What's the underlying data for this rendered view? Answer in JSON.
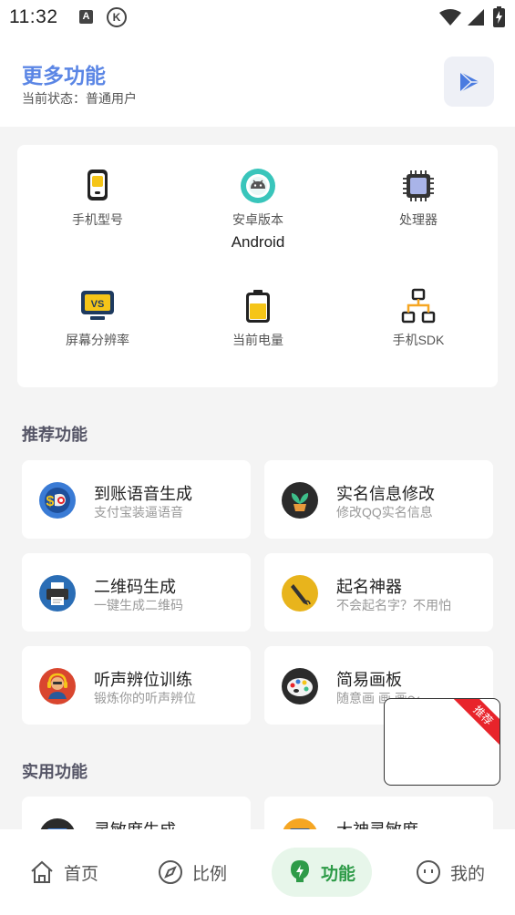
{
  "status_bar": {
    "time": "11:32",
    "a_badge": "A",
    "k_badge": "K"
  },
  "header": {
    "title": "更多功能",
    "status": "当前状态：普通用户",
    "action_icon": "play-icon",
    "accent": "#5b86e5"
  },
  "device_info": [
    {
      "label": "手机型号",
      "value": "",
      "icon": "phone-icon"
    },
    {
      "label": "安卓版本",
      "value": "Android",
      "icon": "android-icon"
    },
    {
      "label": "处理器",
      "value": "",
      "icon": "cpu-icon"
    },
    {
      "label": "屏幕分辨率",
      "value": "",
      "icon": "monitor-icon"
    },
    {
      "label": "当前电量",
      "value": "",
      "icon": "battery-icon"
    },
    {
      "label": "手机SDK",
      "value": "",
      "icon": "sdk-icon"
    }
  ],
  "recommended": {
    "title": "推荐功能",
    "items": [
      {
        "title": "到账语音生成",
        "subtitle": "支付宝装逼语音",
        "icon": "payment-voice-icon"
      },
      {
        "title": "实名信息修改",
        "subtitle": "修改QQ实名信息",
        "icon": "plant-icon"
      },
      {
        "title": "二维码生成",
        "subtitle": "一键生成二维码",
        "icon": "printer-icon"
      },
      {
        "title": "起名神器",
        "subtitle": "不会起名字？不用怕",
        "icon": "pen-icon"
      },
      {
        "title": "听声辨位训练",
        "subtitle": "锻炼你的听声辨位",
        "icon": "headphone-person-icon"
      },
      {
        "title": "简易画板",
        "subtitle": "随意画 画 画～",
        "icon": "palette-icon"
      }
    ]
  },
  "practical": {
    "title": "实用功能",
    "items": [
      {
        "title": "灵敏度生成",
        "icon": "monitor-app-icon"
      },
      {
        "title": "大神灵敏度",
        "icon": "folder-app-icon"
      }
    ]
  },
  "floating_ad": {
    "ribbon": "推荐"
  },
  "bottom_nav": [
    {
      "label": "首页",
      "icon": "home-icon"
    },
    {
      "label": "比例",
      "icon": "compass-icon"
    },
    {
      "label": "功能",
      "icon": "bolt-icon",
      "active": true
    },
    {
      "label": "我的",
      "icon": "face-icon"
    }
  ]
}
